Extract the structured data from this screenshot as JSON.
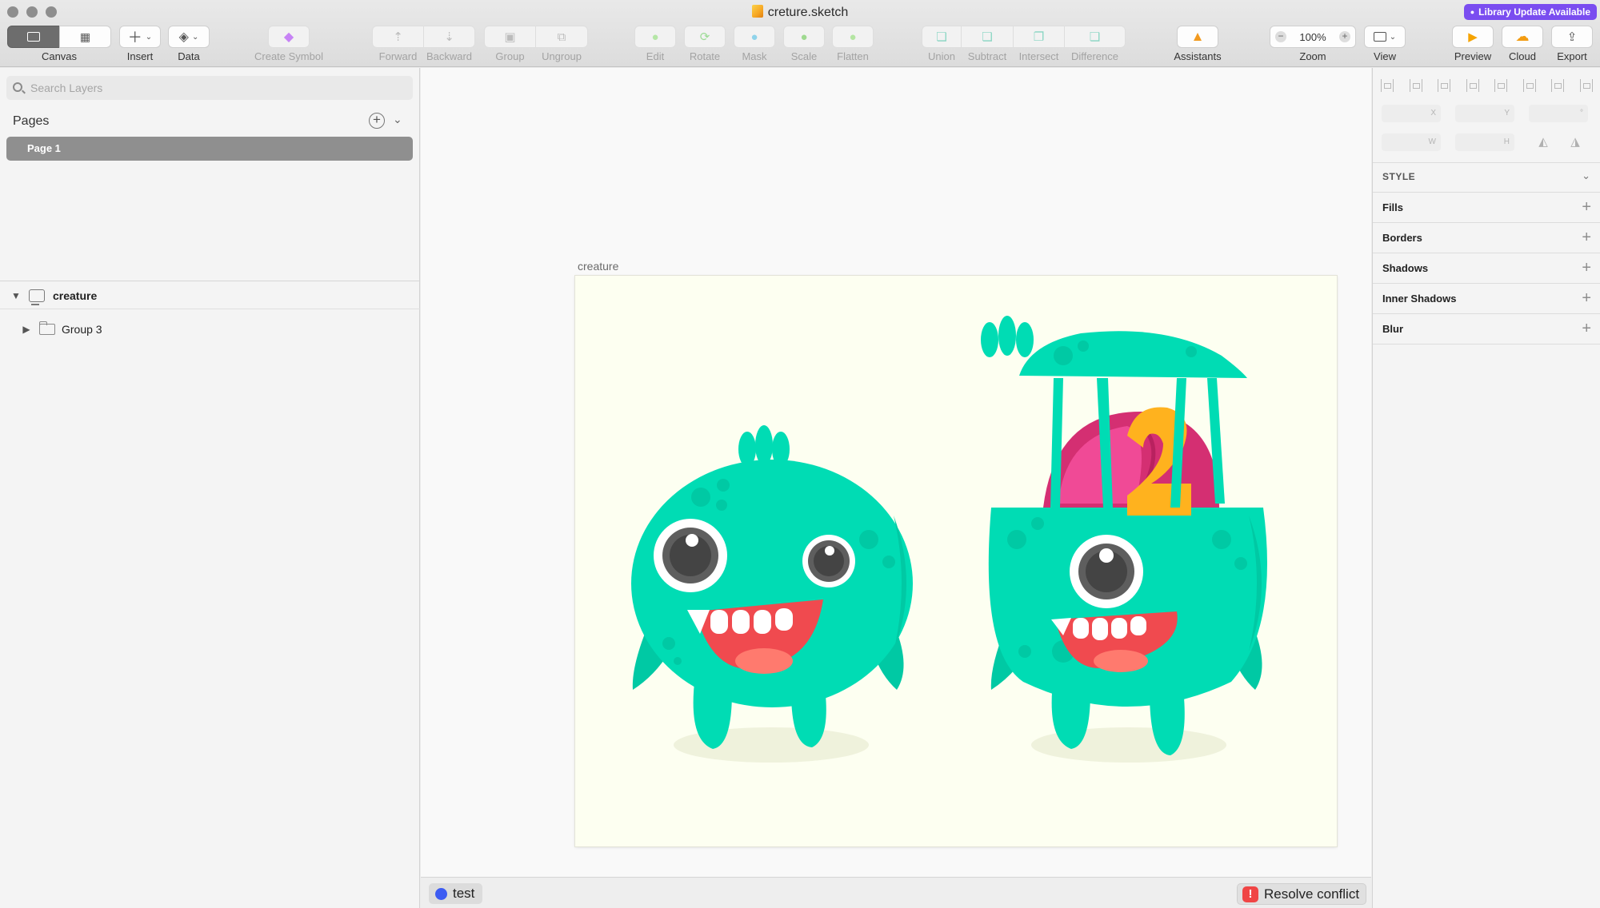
{
  "window": {
    "title": "creture.sketch",
    "library_badge": "Library Update Available"
  },
  "toolbar": {
    "canvas_label": "Canvas",
    "insert_label": "Insert",
    "data_label": "Data",
    "create_symbol_label": "Create Symbol",
    "forward_label": "Forward",
    "backward_label": "Backward",
    "group_label": "Group",
    "ungroup_label": "Ungroup",
    "edit_label": "Edit",
    "rotate_label": "Rotate",
    "mask_label": "Mask",
    "scale_label": "Scale",
    "flatten_label": "Flatten",
    "union_label": "Union",
    "subtract_label": "Subtract",
    "intersect_label": "Intersect",
    "difference_label": "Difference",
    "assistants_label": "Assistants",
    "zoom_label": "Zoom",
    "zoom_value": "100%",
    "view_label": "View",
    "preview_label": "Preview",
    "cloud_label": "Cloud",
    "export_label": "Export"
  },
  "left_panel": {
    "search_placeholder": "Search Layers",
    "pages_label": "Pages",
    "pages": [
      {
        "label": "Page 1",
        "selected": true
      }
    ],
    "layers": [
      {
        "name": "creature",
        "type": "artboard",
        "expanded": true
      },
      {
        "name": "Group 3",
        "type": "group",
        "expanded": false
      }
    ]
  },
  "canvas": {
    "artboard_name": "creature",
    "artboard_bg": "#fdfff1",
    "creature_color": "#00dcb4",
    "mouth_color": "#f04a4f",
    "tongue_color": "#ff7a6e",
    "brain_color": "#d42f72",
    "sign_color": "#ffb21e"
  },
  "status_bar": {
    "user_name": "test",
    "user_color": "#3d5cf2",
    "resolve_label": "Resolve conflict",
    "resolve_icon": "!"
  },
  "inspector": {
    "fields": {
      "x": "X",
      "y": "Y",
      "rotation": "°",
      "w": "W",
      "h": "H"
    },
    "style_header": "STYLE",
    "style_rows": [
      "Fills",
      "Borders",
      "Shadows",
      "Inner Shadows",
      "Blur"
    ]
  }
}
